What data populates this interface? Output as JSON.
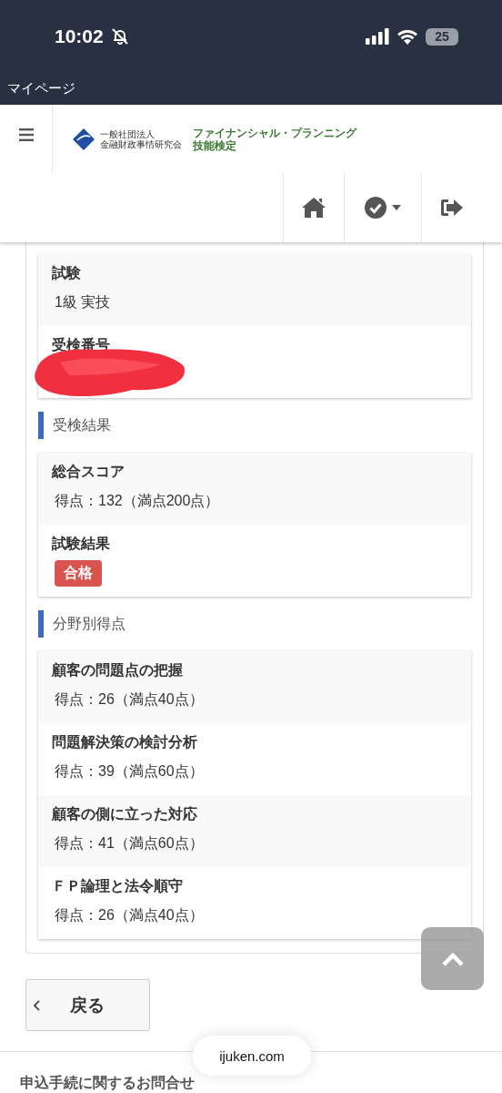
{
  "status_bar": {
    "time": "10:02",
    "battery": "25"
  },
  "app_title": "マイページ",
  "header": {
    "logo": {
      "org_caption": "一般社団法人",
      "org_name": "金融財政事情研究会",
      "product_line1": "ファイナンシャル・プランニング",
      "product_line2": "技能検定"
    },
    "nav": [
      {
        "kind": "home"
      },
      {
        "kind": "check-menu"
      },
      {
        "kind": "logout"
      }
    ]
  },
  "cards": [
    {
      "rows": [
        {
          "label": "試験",
          "value": "1級 実技"
        },
        {
          "label": "受検番号",
          "redacted": true
        }
      ]
    },
    {
      "heading": "受検結果",
      "rows": [
        {
          "label": "総合スコア",
          "value": "得点：132（満点200点）"
        },
        {
          "label": "試験結果",
          "badge": "合格"
        }
      ]
    },
    {
      "heading": "分野別得点",
      "rows": [
        {
          "label": "顧客の問題点の把握",
          "value": "得点：26（満点40点）"
        },
        {
          "label": "問題解決策の検討分析",
          "value": "得点：39（満点60点）"
        },
        {
          "label": "顧客の側に立った対応",
          "value": "得点：41（満点60点）"
        },
        {
          "label": "ＦＰ論理と法令順守",
          "value": "得点：26（満点40点）"
        }
      ]
    }
  ],
  "back_button": "戻る",
  "url_pill": "ijuken.com",
  "footer_link": "申込手続に関するお問合せ"
}
